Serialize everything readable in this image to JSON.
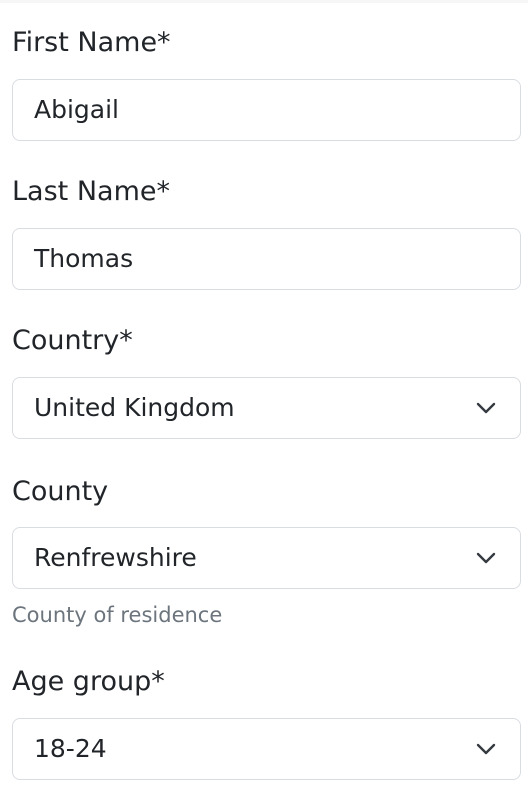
{
  "form": {
    "first_name": {
      "label": "First Name*",
      "value": "Abigail"
    },
    "last_name": {
      "label": "Last Name*",
      "value": "Thomas"
    },
    "country": {
      "label": "Country*",
      "value": "United Kingdom"
    },
    "county": {
      "label": "County",
      "value": "Renfrewshire",
      "help": "County of residence"
    },
    "age_group": {
      "label": "Age group*",
      "value": "18-24"
    }
  },
  "icons": {
    "select_arrow": "chevron-down-icon"
  },
  "colors": {
    "text": "#212529",
    "muted_text": "#6c757d",
    "border": "#d9dde1",
    "background": "#ffffff"
  }
}
